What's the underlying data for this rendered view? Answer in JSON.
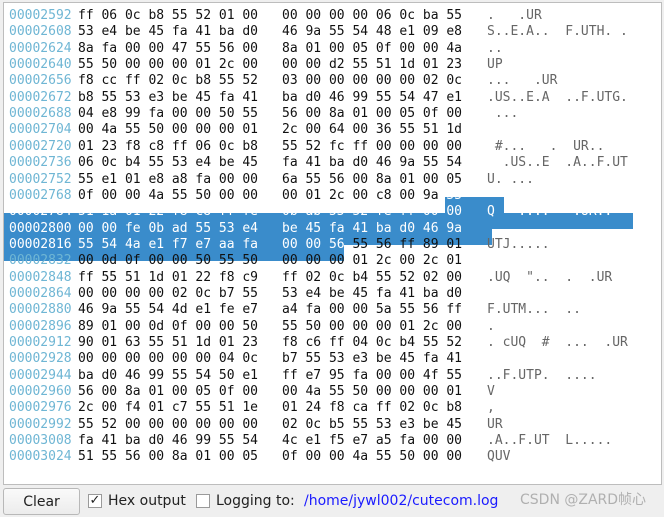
{
  "hexview": {
    "selection_color": "#3a8ccb",
    "address_color": "#6fb6d4",
    "rows": [
      {
        "addr": "00002592",
        "hex1": "ff 06 0c b8 55 52 01 00",
        "hex2": "00 00 00 00 06 0c ba 55",
        "ascii": ".   .UR"
      },
      {
        "addr": "00002608",
        "hex1": "53 e4 be 45 fa 41 ba d0",
        "hex2": "46 9a 55 54 48 e1 09 e8",
        "ascii": "S..E.A..  F.UTH. ."
      },
      {
        "addr": "00002624",
        "hex1": "8a fa 00 00 47 55 56 00",
        "hex2": "8a 01 00 05 0f 00 00 4a",
        "ascii": ".."
      },
      {
        "addr": "00002640",
        "hex1": "55 50 00 00 00 01 2c 00",
        "hex2": "00 00 d2 55 51 1d 01 23",
        "ascii": "UP"
      },
      {
        "addr": "00002656",
        "hex1": "f8 cc ff 02 0c b8 55 52",
        "hex2": "03 00 00 00 00 00 02 0c",
        "ascii": "...   .UR"
      },
      {
        "addr": "00002672",
        "hex1": "b8 55 53 e3 be 45 fa 41",
        "hex2": "ba d0 46 99 55 54 47 e1",
        "ascii": ".US..E.A  ..F.UTG."
      },
      {
        "addr": "00002688",
        "hex1": "04 e8 99 fa 00 00 50 55",
        "hex2": "56 00 8a 01 00 05 0f 00",
        "ascii": " ..."
      },
      {
        "addr": "00002704",
        "hex1": "00 4a 55 50 00 00 00 01",
        "hex2": "2c 00 64 00 36 55 51 1d",
        "ascii": ""
      },
      {
        "addr": "00002720",
        "hex1": "01 23 f8 c8 ff 06 0c b8",
        "hex2": "55 52 fc ff 00 00 00 00",
        "ascii": " #...   .  UR.."
      },
      {
        "addr": "00002736",
        "hex1": "06 0c b4 55 53 e4 be 45",
        "hex2": "fa 41 ba d0 46 9a 55 54",
        "ascii": "  .US..E  .A..F.UT"
      },
      {
        "addr": "00002752",
        "hex1": "55 e1 01 e8 a8 fa 00 00",
        "hex2": "6a 55 56 00 8a 01 00 05",
        "ascii": "U. ..."
      },
      {
        "addr": "00002768",
        "hex1": "0f 00 00 4a 55 50 00 00",
        "hex2": "00 01 2c 00 c8 00 9a 55",
        "ascii": ""
      },
      {
        "addr": "00002784",
        "hex1": "51 1a 01 22 f8 c8 ff fe",
        "hex2": "0b ab 55 52 fe ff 00 00",
        "ascii": "Q  \"....   .UR.."
      },
      {
        "addr": "00002800",
        "hex1": "00 00 fe 0b ad 55 53 e4",
        "hex2": "be 45 fa 41 ba d0 46 9a",
        "ascii": ""
      },
      {
        "addr": "00002816",
        "hex1": "55 54 4a e1 f7 e7 aa fa",
        "hex2": "00 00 56 55 56 ff 89 01",
        "ascii": "UTJ....."
      },
      {
        "addr": "00002832",
        "hex1": "00 0d 0f 00 00 50 55 50",
        "hex2": "00 00 00 01 2c 00 2c 01",
        "ascii": ""
      },
      {
        "addr": "00002848",
        "hex1": "ff 55 51 1d 01 22 f8 c9",
        "hex2": "ff 02 0c b4 55 52 02 00",
        "ascii": ".UQ  \"..  .  .UR"
      },
      {
        "addr": "00002864",
        "hex1": "00 00 00 00 02 0c b7 55",
        "hex2": "53 e4 be 45 fa 41 ba d0",
        "ascii": ""
      },
      {
        "addr": "00002880",
        "hex1": "46 9a 55 54 4d e1 fe e7",
        "hex2": "a4 fa 00 00 5a 55 56 ff",
        "ascii": "F.UTM...  .."
      },
      {
        "addr": "00002896",
        "hex1": "89 01 00 0d 0f 00 00 50",
        "hex2": "55 50 00 00 00 01 2c 00",
        "ascii": "."
      },
      {
        "addr": "00002912",
        "hex1": "90 01 63 55 51 1d 01 23",
        "hex2": "f8 c6 ff 04 0c b4 55 52",
        "ascii": ". cUQ  #  ...  .UR"
      },
      {
        "addr": "00002928",
        "hex1": "00 00 00 00 00 00 04 0c",
        "hex2": "b7 55 53 e3 be 45 fa 41",
        "ascii": ""
      },
      {
        "addr": "00002944",
        "hex1": "ba d0 46 99 55 54 50 e1",
        "hex2": "ff e7 95 fa 00 00 4f 55",
        "ascii": "..F.UTP.  ...."
      },
      {
        "addr": "00002960",
        "hex1": "56 00 8a 01 00 05 0f 00",
        "hex2": "00 4a 55 50 00 00 00 01",
        "ascii": "V"
      },
      {
        "addr": "00002976",
        "hex1": "2c 00 f4 01 c7 55 51 1e",
        "hex2": "01 24 f8 ca ff 02 0c b8",
        "ascii": ","
      },
      {
        "addr": "00002992",
        "hex1": "55 52 00 00 00 00 00 00",
        "hex2": "02 0c b5 55 53 e3 be 45",
        "ascii": "UR"
      },
      {
        "addr": "00003008",
        "hex1": "fa 41 ba d0 46 99 55 54",
        "hex2": "4c e1 f5 e7 a5 fa 00 00",
        "ascii": ".A..F.UT  L....."
      },
      {
        "addr": "00003024",
        "hex1": "51 55 56 00 8a 01 00 05",
        "hex2": "0f 00 00 4a 55 50 00 00",
        "ascii": "QUV"
      }
    ]
  },
  "bottom": {
    "clear_label": "Clear",
    "hex_output_label": "Hex output",
    "hex_output_checked": true,
    "check_mark": "✓",
    "logging_label": "Logging to:",
    "logging_checked": false,
    "log_path": "/home/jywl002/cutecom.log",
    "path_color": "#1a1aff"
  },
  "watermark": "CSDN @ZARD帧心"
}
